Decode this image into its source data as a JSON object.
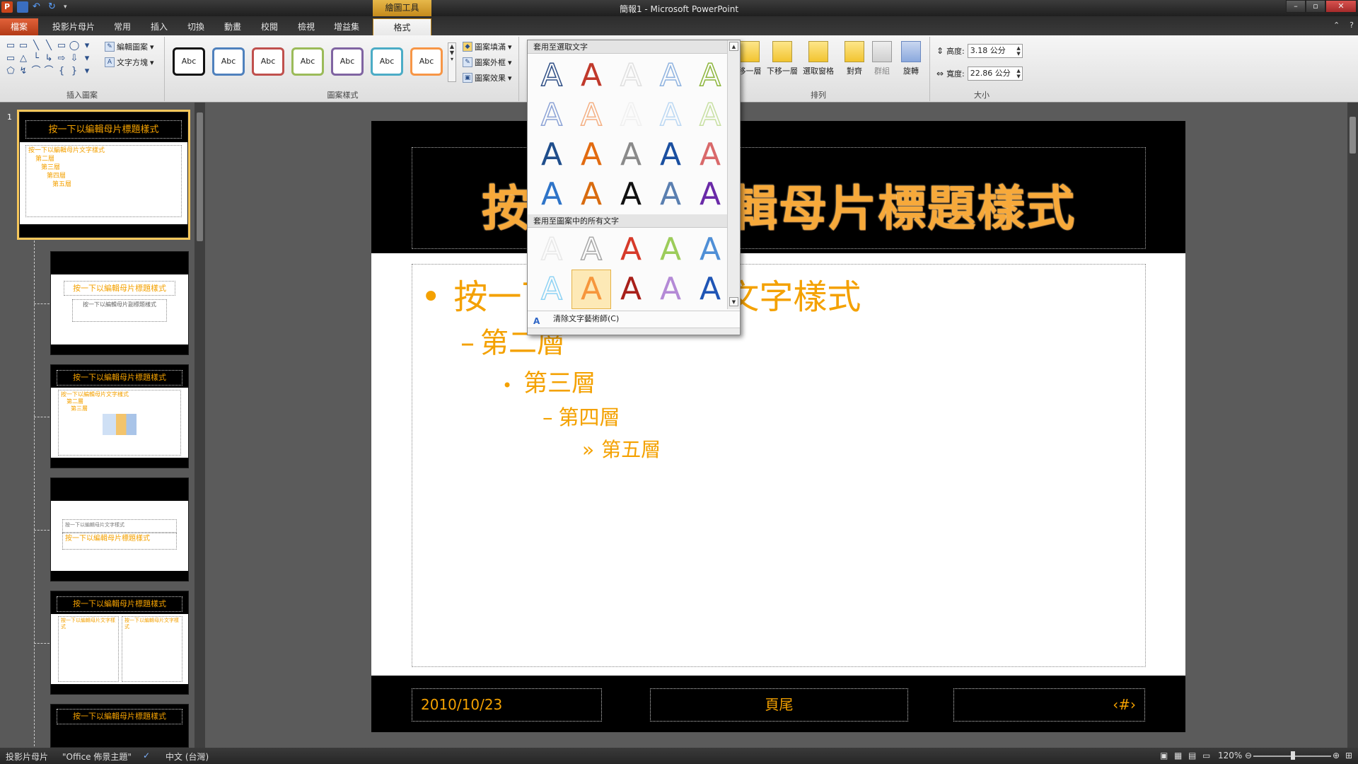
{
  "window": {
    "title": "簡報1 - Microsoft PowerPoint",
    "contextual_tools": "繪圖工具",
    "controls": [
      "–",
      "▫",
      "✕"
    ]
  },
  "tabs": [
    {
      "label": "檔案"
    },
    {
      "label": "投影片母片"
    },
    {
      "label": "常用"
    },
    {
      "label": "插入"
    },
    {
      "label": "切換"
    },
    {
      "label": "動畫"
    },
    {
      "label": "校閱"
    },
    {
      "label": "檢視"
    },
    {
      "label": "增益集"
    },
    {
      "label": "格式"
    }
  ],
  "ribbon": {
    "insert_shapes": {
      "label": "插入圖案",
      "edit_shape": "編輯圖案",
      "text_box": "文字方塊",
      "shapes": [
        "▭",
        "▭",
        "╲",
        "╲",
        "▭",
        "◯",
        "▾",
        "▭",
        "△",
        "└",
        "↳",
        "⇨",
        "⇩",
        "▾",
        "⬠",
        "↯",
        "⌒",
        "⌒",
        "{",
        "}",
        "▾"
      ]
    },
    "shape_styles": {
      "label": "圖案樣式",
      "presets": [
        {
          "text": "Abc",
          "color": "#111111"
        },
        {
          "text": "Abc",
          "color": "#4f81bd"
        },
        {
          "text": "Abc",
          "color": "#c0504d"
        },
        {
          "text": "Abc",
          "color": "#9bbb59"
        },
        {
          "text": "Abc",
          "color": "#8064a2"
        },
        {
          "text": "Abc",
          "color": "#4bacc6"
        },
        {
          "text": "Abc",
          "color": "#f79646"
        }
      ],
      "fill": "圖案填滿",
      "outline": "圖案外框",
      "effects": "圖案效果"
    },
    "arrange": {
      "label": "排列",
      "bring_forward": "移一層",
      "send_backward": "下移一層",
      "selection_pane": "選取窗格",
      "align": "對齊",
      "group": "群組",
      "rotate": "旋轉"
    },
    "size": {
      "label": "大小",
      "height_label": "高度:",
      "height_value": "3.18 公分",
      "width_label": "寬度:",
      "width_value": "22.86 公分"
    }
  },
  "wordart": {
    "section1_title": "套用至選取文字",
    "section2_title": "套用至圖案中的所有文字",
    "clear": "清除文字藝術師(C)",
    "glyph": "A",
    "section1_colors": [
      "#2f4f86",
      "#c0392b",
      "#e0e0e0",
      "#8fb3e0",
      "#8db63c",
      "#8ca3d6",
      "#f4b084",
      "#f0f0f0",
      "#bcd8f3",
      "#c8e0a3",
      "#1f4e8c",
      "#e26b10",
      "#8a8a8a",
      "#1a4fa0",
      "#d9696a",
      "#2e74c8",
      "#d86b0f",
      "#111111",
      "#5a7fb0",
      "#6a2aa8"
    ],
    "section2_colors": [
      "#e8e8e8",
      "#a8a8a8",
      "#d63a2a",
      "#9ccc5a",
      "#4f8fd6",
      "#8fd3f4",
      "#f6963c",
      "#a8201a",
      "#b48ad6",
      "#1f55b5"
    ]
  },
  "slide_panel": {
    "first_number": "1",
    "thumb_title": "按一下以編輯母片標題樣式",
    "thumb_text": "按一下以編輯母片文字樣式",
    "thumb_levels": [
      "第二層",
      "第三層",
      "第四層",
      "第五層"
    ],
    "thumb2_subtitle": "按一下以編輯母片副標題樣式"
  },
  "slide": {
    "title": "按一下以編輯母片標題樣式",
    "body_levels": [
      {
        "bullet": "•",
        "text": "按一下以編輯母片文字樣式"
      },
      {
        "bullet": "–",
        "text": "第二層"
      },
      {
        "bullet": "•",
        "text": "第三層"
      },
      {
        "bullet": "–",
        "text": "第四層"
      },
      {
        "bullet": "»",
        "text": "第五層"
      }
    ],
    "footer_date": "2010/10/23",
    "footer_text": "頁尾",
    "footer_number": "‹#›"
  },
  "status": {
    "view": "投影片母片",
    "theme": "\"Office 佈景主題\"",
    "language": "中文 (台灣)",
    "zoom": "120%"
  }
}
